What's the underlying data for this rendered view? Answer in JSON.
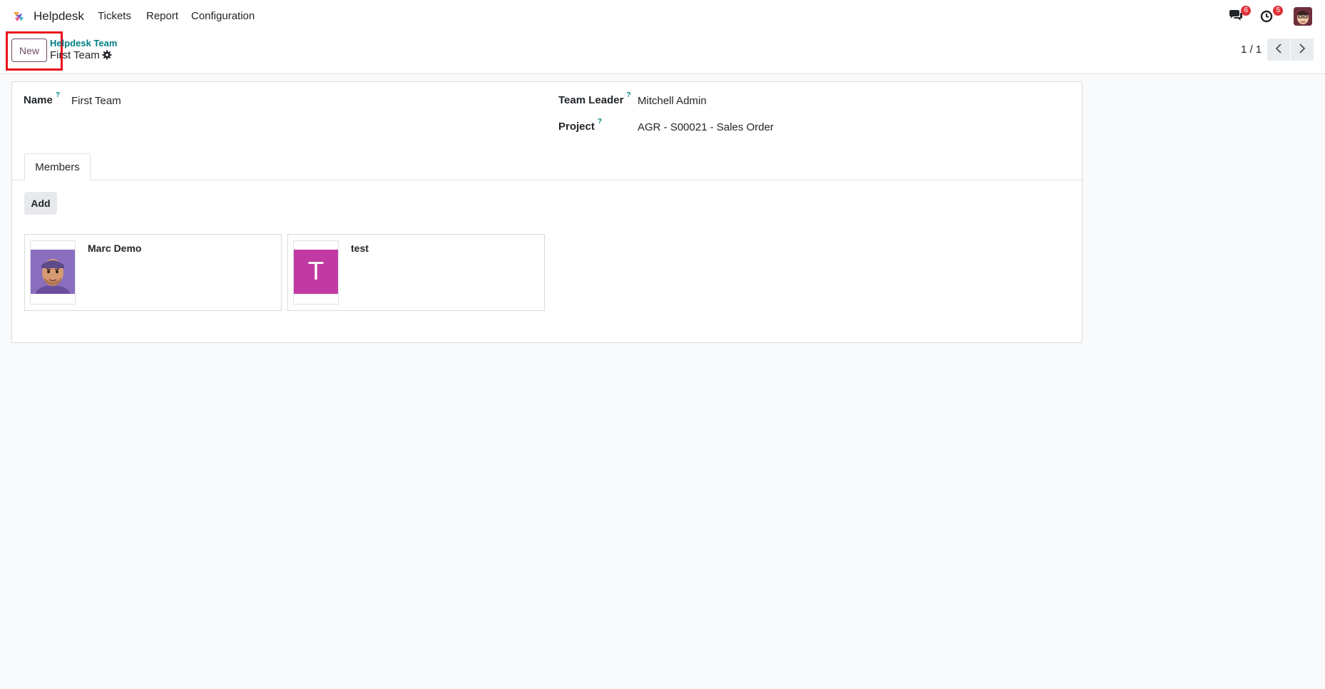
{
  "navbar": {
    "app_name": "Helpdesk",
    "menu": [
      "Tickets",
      "Report",
      "Configuration"
    ],
    "messages_count": "6",
    "activities_count": "5"
  },
  "control_panel": {
    "new_label": "New",
    "breadcrumb_parent": "Helpdesk Team",
    "record_title": "First Team",
    "pager": "1 / 1"
  },
  "form": {
    "name_label": "Name",
    "name_value": "First Team",
    "team_leader_label": "Team Leader",
    "team_leader_value": "Mitchell Admin",
    "project_label": "Project",
    "project_value": "AGR - S00021 - Sales Order",
    "help_mark": "?",
    "tab_members": "Members",
    "add_label": "Add",
    "members": [
      {
        "name": "Marc Demo",
        "avatar": "photo"
      },
      {
        "name": "test",
        "avatar_initial": "T",
        "avatar_color": "#c13aa3"
      }
    ]
  },
  "colors": {
    "brand": "#714b67",
    "link": "#017e84",
    "highlight": "#e8121b",
    "badge": "#e0333a"
  }
}
